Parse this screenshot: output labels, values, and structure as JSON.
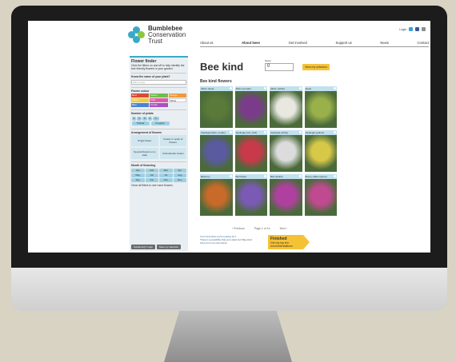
{
  "site": {
    "logo_line1": "Bumblebee",
    "logo_line2": "Conservation",
    "logo_line3": "Trust",
    "login": "Login"
  },
  "nav": [
    "About us",
    "About bees",
    "Get involved",
    "Support us",
    "News",
    "Contact"
  ],
  "sidebar": {
    "title": "Flower finder",
    "intro": "Click the filters on and off to help identify the bee friendly flowers in your garden.",
    "name_label": "Know the name of your plant?",
    "name_placeholder": "Plant name",
    "colour_label": "Flower colour",
    "colours": [
      {
        "name": "Red",
        "hex": "#d94a3c"
      },
      {
        "name": "Green",
        "hex": "#6cbf4b"
      },
      {
        "name": "Orange",
        "hex": "#f09a36"
      },
      {
        "name": "Yellow",
        "hex": "#f2cb3a"
      },
      {
        "name": "Pink",
        "hex": "#e25aa8"
      },
      {
        "name": "White",
        "hex": "#ffffff"
      },
      {
        "name": "Blue",
        "hex": "#4c84d4"
      },
      {
        "name": "Purple",
        "hex": "#a552c4"
      }
    ],
    "petals_label": "Number of petals",
    "petals": [
      "3",
      "4",
      "5",
      "6",
      "7+"
    ],
    "shape": [
      "Tubular",
      "Irregular"
    ],
    "arrangement_label": "Arrangement of flowers",
    "arrangements": [
      "Single flower",
      "Cluster or spike of flowers",
      "Several flowers on a stalk",
      "Umbrella like cluster"
    ],
    "month_label": "Month of flowering",
    "months": [
      "Jan",
      "Feb",
      "Mar",
      "Apr",
      "May",
      "Jun",
      "Jul",
      "Aug",
      "Sep",
      "Oct",
      "Nov",
      "Dec"
    ],
    "clear_text": "Clear all filters to see more flowers",
    "btn_login": "Gardening? Login",
    "btn_save": "Save my selection"
  },
  "main": {
    "bee_logo": "Bee kind",
    "score_label": "Score",
    "score_value": "0",
    "view_btn": "View my selection",
    "section_title": "Bee kind flowers",
    "cards": [
      {
        "title": "Allium (leek)",
        "color": "#5a7a3a"
      },
      {
        "title": "Allium (purple)",
        "color": "#7a3c8a"
      },
      {
        "title": "Allium (white)",
        "color": "#e8e8e0"
      },
      {
        "title": "Apple",
        "color": "#9ab04a"
      },
      {
        "title": "Aquilegia (blue, purple)",
        "color": "#5a5aa0"
      },
      {
        "title": "Aquilegia (red, pink)",
        "color": "#c83a4a"
      },
      {
        "title": "Aquilegia (white)",
        "color": "#dcdcdc"
      },
      {
        "title": "Aquilegia (yellow)",
        "color": "#d8c848"
      },
      {
        "title": "Barberry",
        "color": "#c86a2a"
      },
      {
        "title": "Bell flower",
        "color": "#7a5ab4"
      },
      {
        "title": "Bell heather",
        "color": "#b040a0"
      },
      {
        "title": "Betony (Betonyanol)",
        "color": "#c04a90"
      }
    ],
    "prev": "Previous",
    "page": "Page 1 of 14",
    "next": "Next",
    "cant_find": "Can't find what you're looking for?",
    "cant_find_2": "There's a possibility that your plant isn't Bee kind.",
    "cant_find_3": "Find out more information",
    "finished_title": "Finished",
    "finished_sub": "Get my top ten recommendations"
  }
}
